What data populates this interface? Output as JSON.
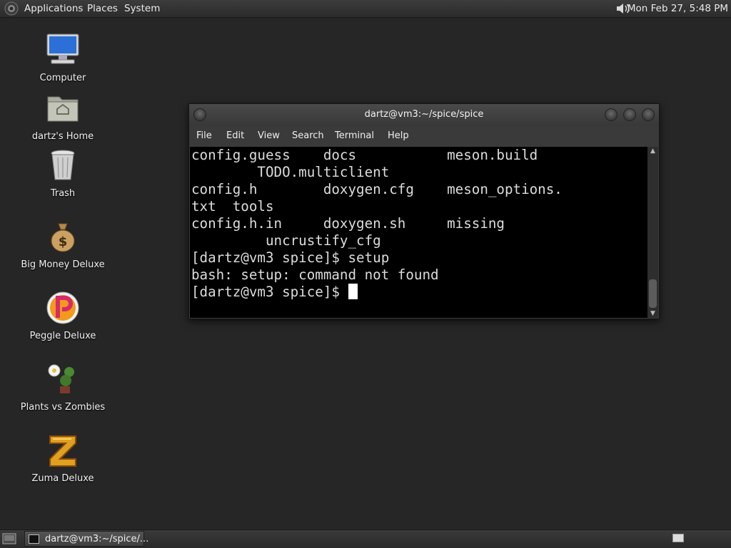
{
  "top_panel": {
    "menus": [
      "Applications",
      "Places",
      "System"
    ],
    "clock": "Mon Feb 27,  5:48 PM"
  },
  "desktop": {
    "icons": [
      {
        "label": "Computer",
        "icon": "computer-icon"
      },
      {
        "label": "dartz's Home",
        "icon": "home-folder-icon"
      },
      {
        "label": "Trash",
        "icon": "trash-icon"
      },
      {
        "label": "Big Money Deluxe",
        "icon": "money-bag-icon"
      },
      {
        "label": "Peggle Deluxe",
        "icon": "peggle-icon"
      },
      {
        "label": "Plants vs Zombies",
        "icon": "plants-icon"
      },
      {
        "label": "Zuma Deluxe",
        "icon": "zuma-icon"
      }
    ]
  },
  "terminal": {
    "title": "dartz@vm3:~/spice/spice",
    "menu": [
      "File",
      "Edit",
      "View",
      "Search",
      "Terminal",
      "Help"
    ],
    "lines": [
      "config.guess    docs           meson.build",
      "        TODO.multiclient",
      "config.h        doxygen.cfg    meson_options.",
      "txt  tools",
      "config.h.in     doxygen.sh     missing",
      "         uncrustify_cfg",
      "[dartz@vm3 spice]$ setup",
      "bash: setup: command not found",
      "[dartz@vm3 spice]$ "
    ]
  },
  "taskbar": {
    "task_label": "dartz@vm3:~/spice/..."
  },
  "colors": {
    "desktop_bg": "#262626",
    "panel_bg": "#333333",
    "terminal_bg": "#000000",
    "terminal_fg": "#dcdcdc"
  }
}
